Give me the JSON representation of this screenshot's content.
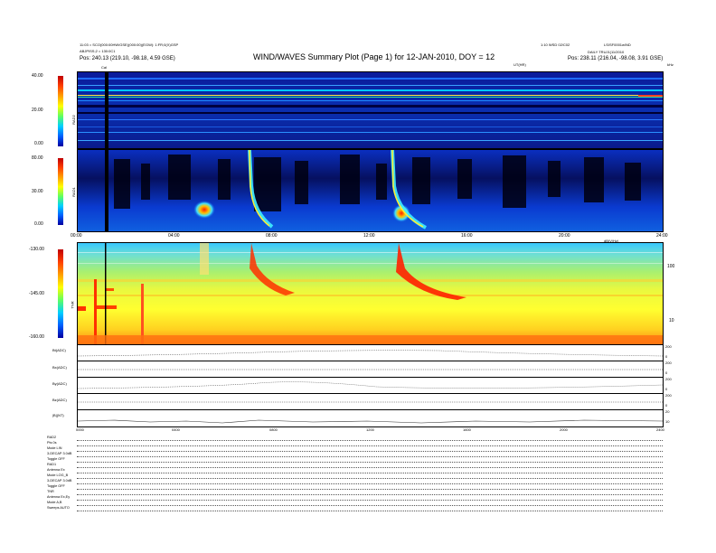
{
  "header": {
    "title": "WIND/WAVES Summary Plot (Page 1) for 12-JAN-2010, DOY = 12",
    "left_line1": "11:03 = SCO(000:00HW/GSE)(000:00)(EGW): 1:FR;0(X)GSP",
    "left_line2": "ABJPISS;2 = 130:0C1",
    "left_line3": "Pos:  240.13 (219.10, -98.18, 4.59 GSE)",
    "right_line1": "1:10 WSD 02/C02",
    "right_line2": "DAILY  TRUJ1(11/2010",
    "right_line3": "Pos:  238.11 (216.04, -98.08, 3.91 GSE)",
    "right_corner": "LS/SF0001w/ND",
    "ut_label": "UT(HR)",
    "ut_label_right": "kHz",
    "marker_cal": "Cal"
  },
  "chart_data": [
    {
      "type": "heatmap",
      "name": "RAD2",
      "ylabel": "RAD2",
      "colorbar_ticks": [
        "40.00",
        "20.00",
        "0.00"
      ],
      "ylim": [
        0,
        40
      ]
    },
    {
      "type": "heatmap",
      "name": "RAD1",
      "ylabel": "RAD1",
      "colorbar_ticks": [
        "80.00",
        "30.00",
        "0.00"
      ],
      "ylim": [
        0,
        80
      ],
      "xticks": [
        "00:00",
        "04:00",
        "08:00",
        "12:00",
        "16:00",
        "20:00",
        "24:00"
      ]
    },
    {
      "type": "heatmap",
      "name": "TNR",
      "ylabel": "TNR",
      "colorbar_ticks": [
        "-130.00",
        "-145.00",
        "-160.00"
      ],
      "right_ticks": [
        "100",
        "10"
      ],
      "top_label": "dB(V/Hz)"
    },
    {
      "type": "line",
      "name": "magnetic-field-strips",
      "strip_labels": [
        "Bt(ADC)",
        "Bx(ADC)",
        "By(ADC)",
        "Bz(ADC)",
        "N(ADC)",
        "|B|(NT)"
      ],
      "strip_right_ticks": [
        [
          "200",
          "0"
        ],
        [
          "200",
          "0"
        ],
        [
          "200",
          "0"
        ],
        [
          "200",
          "0"
        ],
        [
          "200",
          "0"
        ],
        [
          "20",
          "10"
        ]
      ],
      "xticks": [
        "0000",
        "0400",
        "0800",
        "1200",
        "1600",
        "2000",
        "2400"
      ]
    }
  ],
  "status": {
    "rows": [
      "RAD2",
      "Pts      0s",
      "Mode   LIN",
      "3-DECAP  3.0dB",
      "Toggle   OFF",
      "RAD1",
      "Antenna   Ex",
      "Mode   LOG_B",
      "3-DECAP  3.0dB",
      "Toggle   OFF",
      "TNR",
      "Antenna   Ex,Ey",
      "Mode   A,B",
      "Sweeps   AUTO"
    ]
  },
  "colors": {
    "background_dark": "#0a1a8c",
    "scale_low": "#00008f",
    "scale_high": "#ff0000"
  }
}
